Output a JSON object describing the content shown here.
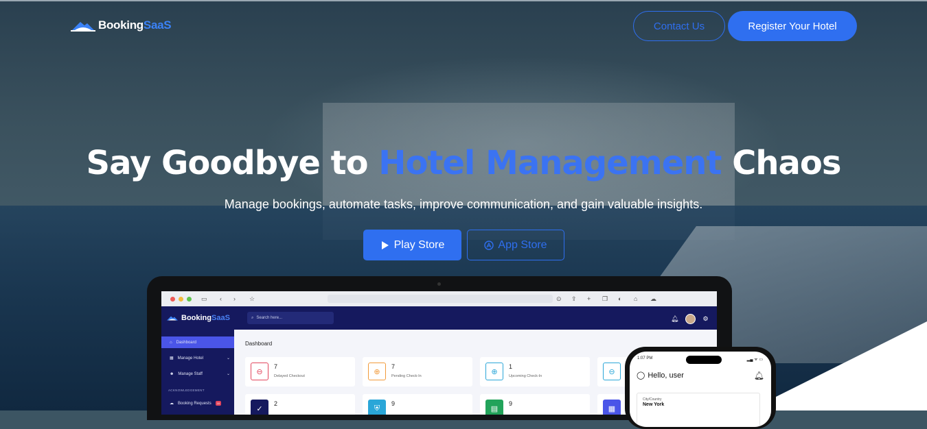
{
  "brand": {
    "name_part1": "Booking",
    "name_part2": "SaaS",
    "accent": "#2f6ff0"
  },
  "nav": {
    "contact_label": "Contact Us",
    "register_label": "Register Your Hotel"
  },
  "hero": {
    "headline_pre": "Say Goodbye to ",
    "headline_highlight": "Hotel Management",
    "headline_post": " Chaos",
    "subheadline": "Manage bookings, automate tasks, improve communication, and gain valuable insights.",
    "play_store_label": "Play Store",
    "app_store_label": "App Store"
  },
  "dashboard": {
    "logo_part1": "Booking",
    "logo_part2": "SaaS",
    "search_placeholder": "Search here...",
    "title": "Dashboard",
    "sidebar": {
      "items": [
        {
          "label": "Dashboard",
          "icon": "home-icon"
        },
        {
          "label": "Manage Hotel",
          "icon": "hotel-icon"
        },
        {
          "label": "Manage Staff",
          "icon": "staff-icon"
        }
      ],
      "section_label": "ACKNOWLEDGEMENT",
      "booking_requests_label": "Booking Requests",
      "booking_requests_badge": "10"
    },
    "cards": [
      {
        "value": "7",
        "label": "Delayed Checkout",
        "color": "#e2445c"
      },
      {
        "value": "7",
        "label": "Pending Check-In",
        "color": "#f29a3a"
      },
      {
        "value": "1",
        "label": "Upcoming Check-In",
        "color": "#2aa6d8"
      },
      {
        "value": "",
        "label": "",
        "color": "#2aa6d8"
      }
    ],
    "cards_row2": [
      {
        "value": "2",
        "color": "#15195e"
      },
      {
        "value": "9",
        "color": "#2aa6d8"
      },
      {
        "value": "9",
        "color": "#22a35a"
      },
      {
        "value": "",
        "color": "#4a55e8"
      }
    ]
  },
  "phone": {
    "time": "1:07 PM",
    "greeting": "Hello, user",
    "city_label": "City/Country",
    "city_value": "New York"
  }
}
